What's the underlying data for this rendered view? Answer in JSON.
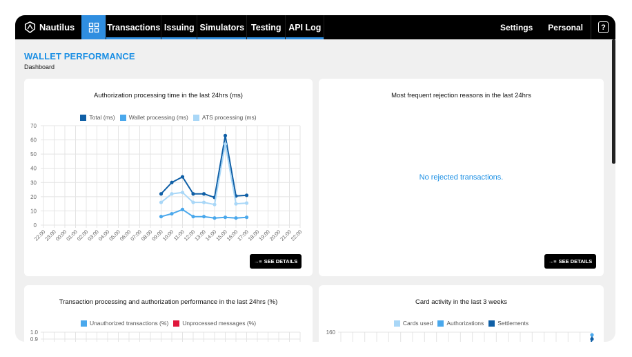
{
  "app": {
    "name": "Nautilus"
  },
  "nav": {
    "items": [
      "Transactions",
      "Issuing",
      "Simulators",
      "Testing",
      "API Log"
    ],
    "right": [
      "Settings",
      "Personal"
    ],
    "help_label": "?"
  },
  "page": {
    "title": "WALLET PERFORMANCE",
    "subtitle": "Dashboard"
  },
  "colors": {
    "accent": "#2f8ee0",
    "dark_blue": "#0f5fa6",
    "mid_blue": "#4aa8ec",
    "light_blue": "#a9d7f7",
    "red": "#e0173c"
  },
  "cards": {
    "auth_time": {
      "title": "Authorization processing time in the last 24hrs (ms)",
      "button": "SEE DETAILS"
    },
    "rejections": {
      "title": "Most frequent rejection reasons in the last 24hrs",
      "empty": "No rejected transactions.",
      "button": "SEE DETAILS"
    },
    "performance": {
      "title": "Transaction processing and authorization performance in the last 24hrs (%)"
    },
    "card_activity": {
      "title": "Card activity in the last 3 weeks"
    }
  },
  "chart_data": [
    {
      "type": "line",
      "title": "Authorization processing time in the last 24hrs (ms)",
      "categories": [
        "22:00",
        "23:00",
        "00:00",
        "01:00",
        "02:00",
        "03:00",
        "04:00",
        "05:00",
        "06:00",
        "07:00",
        "08:00",
        "09:00",
        "10:00",
        "11:00",
        "12:00",
        "13:00",
        "14:00",
        "15:00",
        "16:00",
        "17:00",
        "18:00",
        "19:00",
        "20:00",
        "21:00",
        "22:00"
      ],
      "ylim": [
        0,
        70
      ],
      "yticks": [
        0,
        10,
        20,
        30,
        40,
        50,
        60,
        70
      ],
      "grid": true,
      "legend": "top",
      "series": [
        {
          "name": "Total (ms)",
          "color": "#0f5fa6",
          "values": [
            null,
            null,
            null,
            null,
            null,
            null,
            null,
            null,
            null,
            null,
            null,
            22,
            30,
            34,
            22,
            22,
            19.5,
            63,
            20.5,
            21,
            null,
            null,
            null,
            null,
            null
          ]
        },
        {
          "name": "Wallet processing (ms)",
          "color": "#4aa8ec",
          "values": [
            null,
            null,
            null,
            null,
            null,
            null,
            null,
            null,
            null,
            null,
            null,
            6,
            8,
            11,
            6,
            6,
            5,
            5.5,
            5,
            5.5,
            null,
            null,
            null,
            null,
            null
          ]
        },
        {
          "name": "ATS processing (ms)",
          "color": "#a9d7f7",
          "values": [
            null,
            null,
            null,
            null,
            null,
            null,
            null,
            null,
            null,
            null,
            null,
            16,
            22,
            23,
            16,
            16,
            14.5,
            57,
            15,
            15.5,
            null,
            null,
            null,
            null,
            null
          ]
        }
      ]
    },
    {
      "type": "bar",
      "title": "Transaction processing and authorization performance in the last 24hrs (%)",
      "legend": "top",
      "ylim": [
        0,
        1.0
      ],
      "yticks": [
        1.0,
        0.9
      ],
      "series": [
        {
          "name": "Unauthorized transactions (%)",
          "color": "#4aa8ec",
          "values": []
        },
        {
          "name": "Unprocessed messages (%)",
          "color": "#e0173c",
          "values": []
        }
      ]
    },
    {
      "type": "line",
      "title": "Card activity in the last 3 weeks",
      "legend": "top",
      "yticks": [
        160
      ],
      "series": [
        {
          "name": "Cards used",
          "color": "#a9d7f7",
          "values": []
        },
        {
          "name": "Authorizations",
          "color": "#4aa8ec",
          "values": []
        },
        {
          "name": "Settlements",
          "color": "#0f5fa6",
          "values": []
        }
      ]
    }
  ]
}
